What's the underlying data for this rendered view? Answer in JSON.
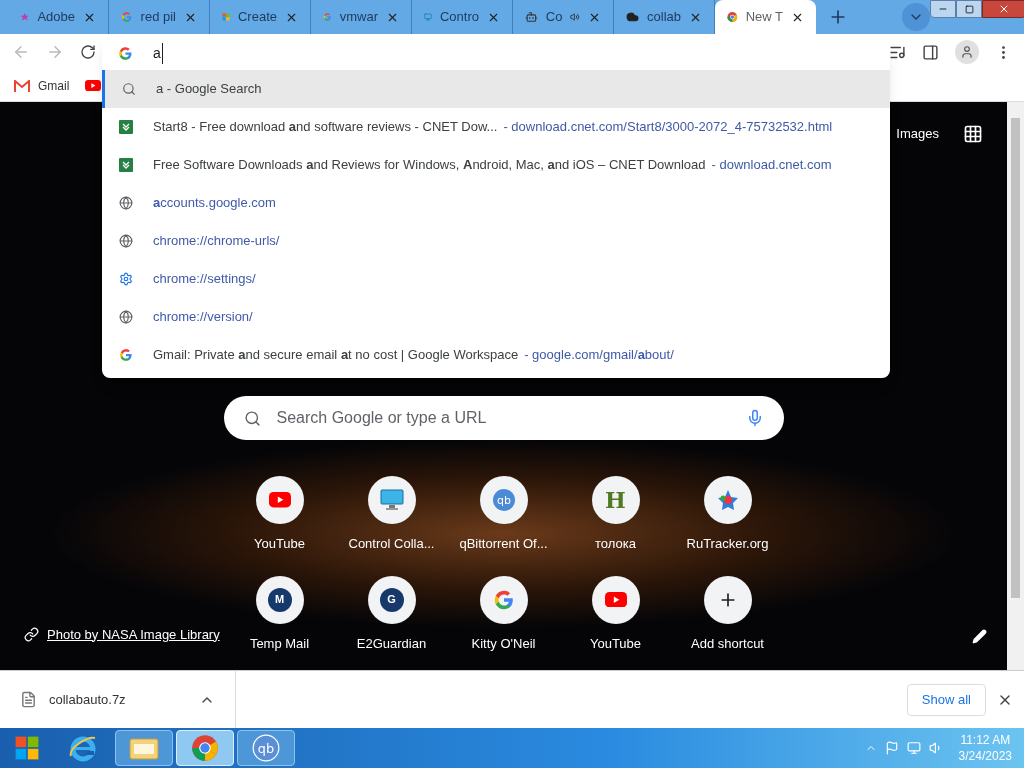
{
  "tabs": [
    {
      "title": "Adobe",
      "kind": "adobe",
      "selected": false,
      "audio": false
    },
    {
      "title": "red pil",
      "kind": "google",
      "selected": false,
      "audio": false
    },
    {
      "title": "Create",
      "kind": "windows",
      "selected": false,
      "audio": false
    },
    {
      "title": "vmwar",
      "kind": "google",
      "selected": false,
      "audio": false
    },
    {
      "title": "Contro",
      "kind": "monitor",
      "selected": false,
      "audio": false
    },
    {
      "title": "Co",
      "kind": "robot",
      "selected": false,
      "audio": true
    },
    {
      "title": "collab",
      "kind": "cloud",
      "selected": false,
      "audio": false
    },
    {
      "title": "New T",
      "kind": "chrome",
      "selected": true,
      "audio": false
    }
  ],
  "omnibox": {
    "value": "a"
  },
  "suggestions": [
    {
      "kind": "search",
      "text": "a - Google Search",
      "selected": true
    },
    {
      "kind": "cnet",
      "text": "Start8 - Free download **a**nd software reviews - CNET Dow...",
      "url": "- download.cnet.com/Start8/3000-2072_4-75732532.html",
      "selected": false
    },
    {
      "kind": "cnet",
      "text": "Free Software Downloads **a**nd Reviews for Windows, **A**ndroid, Mac, **a**nd iOS – CNET Download",
      "url": "- download.cnet.com",
      "selected": false
    },
    {
      "kind": "globe",
      "url": "**a**ccounts.google.com",
      "selected": false
    },
    {
      "kind": "globe",
      "url": "chrome://chrome-urls/",
      "selected": false
    },
    {
      "kind": "settings",
      "url": "chrome://settings/",
      "selected": false
    },
    {
      "kind": "globe",
      "url": "chrome://version/",
      "selected": false
    },
    {
      "kind": "google",
      "text": "Gmail: Private **a**nd secure email **a**t no cost | Google Workspace",
      "url": "- google.com/gmail/**a**bout/",
      "selected": false
    }
  ],
  "bookmarks": [
    {
      "kind": "gmail",
      "label": "Gmail"
    },
    {
      "kind": "youtube"
    }
  ],
  "header_link": "Images",
  "search": {
    "placeholder": "Search Google or type a URL"
  },
  "shortcuts": [
    {
      "kind": "youtube",
      "label": "YouTube"
    },
    {
      "kind": "monitor",
      "label": "Control Colla..."
    },
    {
      "kind": "qb",
      "label": "qBittorrent Of..."
    },
    {
      "kind": "letter",
      "letter": "H",
      "label": "толока"
    },
    {
      "kind": "star",
      "label": "RuTracker.org"
    },
    {
      "kind": "letter_dark",
      "letter": "M",
      "label": "Temp Mail"
    },
    {
      "kind": "letter_dark",
      "letter": "G",
      "label": "E2Guardian"
    },
    {
      "kind": "google",
      "label": "Kitty O'Neil"
    },
    {
      "kind": "youtube",
      "label": "YouTube"
    },
    {
      "kind": "add",
      "label": "Add shortcut"
    }
  ],
  "photo_credit": "Photo by NASA Image Library",
  "download": {
    "filename": "collabauto.7z",
    "show_all": "Show all"
  },
  "taskbar": {
    "apps": [
      {
        "kind": "ie",
        "selected": false
      },
      {
        "kind": "folder",
        "selected": false
      },
      {
        "kind": "chrome",
        "selected": true
      },
      {
        "kind": "qb",
        "selected": false
      }
    ],
    "time": "11:12 AM",
    "date": "3/24/2023"
  }
}
